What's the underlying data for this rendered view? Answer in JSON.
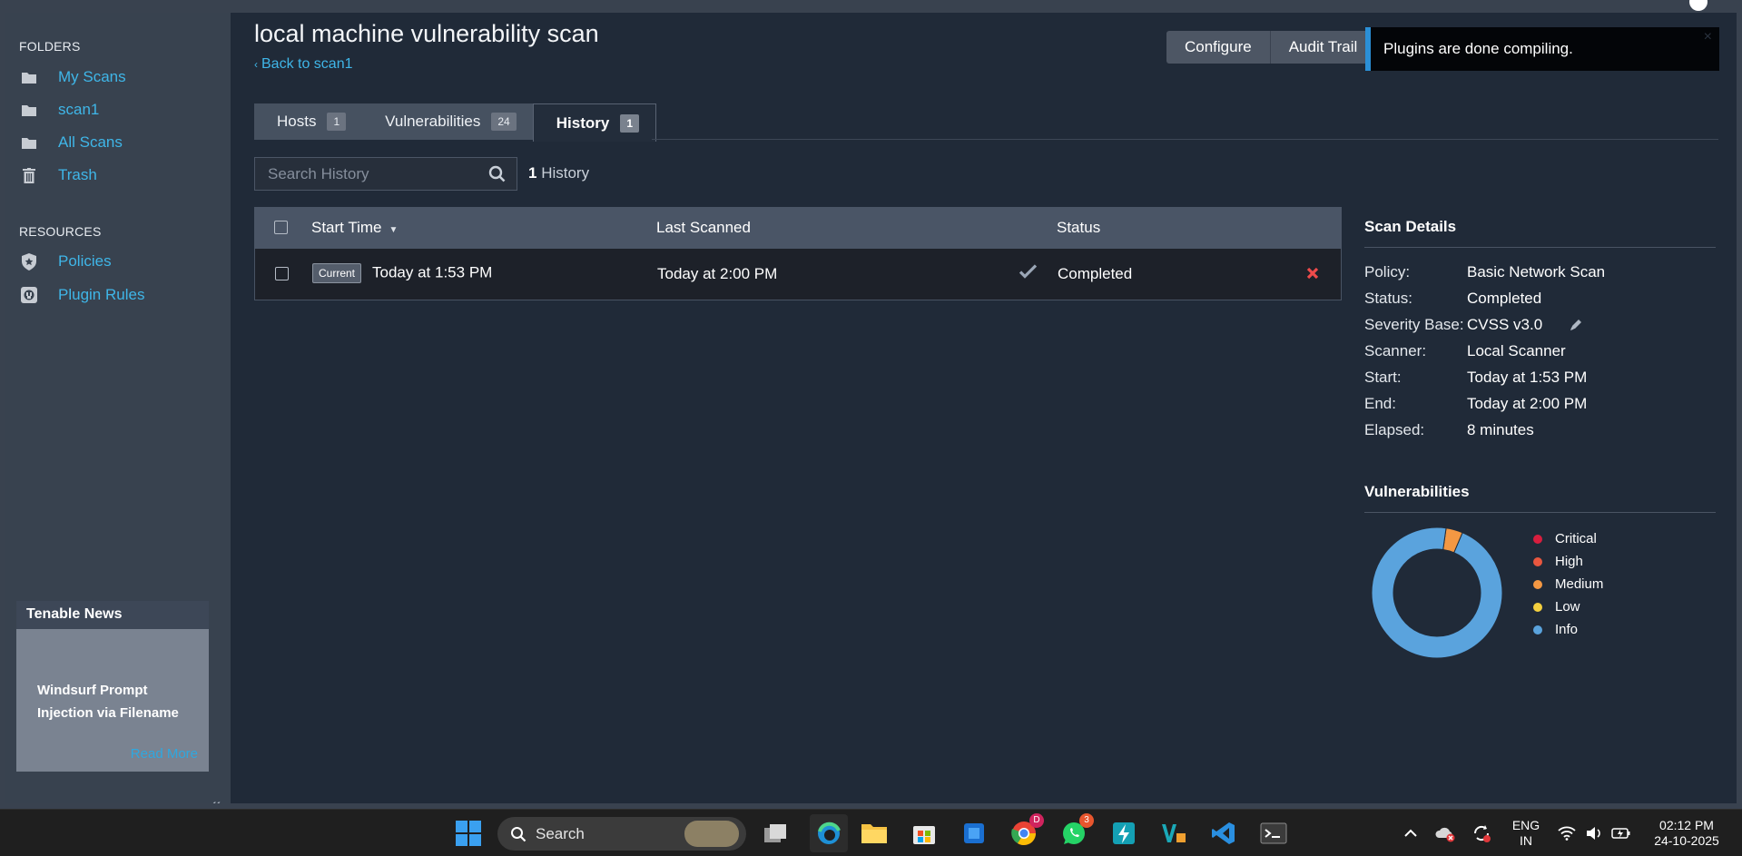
{
  "sidebar": {
    "folders_heading": "FOLDERS",
    "folders": [
      {
        "label": "My Scans",
        "icon": "folder-icon"
      },
      {
        "label": "scan1",
        "icon": "folder-icon"
      },
      {
        "label": "All Scans",
        "icon": "folder-icon"
      },
      {
        "label": "Trash",
        "icon": "trash-icon"
      }
    ],
    "resources_heading": "RESOURCES",
    "resources": [
      {
        "label": "Policies",
        "icon": "policy-icon"
      },
      {
        "label": "Plugin Rules",
        "icon": "plugin-rules-icon"
      }
    ],
    "news": {
      "heading": "Tenable News",
      "title": "Windsurf Prompt Injection via Filename",
      "read_more": "Read More"
    },
    "collapse_icon": "double-chevron-left-icon"
  },
  "header": {
    "title": "local machine vulnerability scan",
    "back_link": "Back to scan1",
    "configure": "Configure",
    "audit_trail": "Audit Trail"
  },
  "toast": {
    "message": "Plugins are done compiling.",
    "close": "×"
  },
  "tabs": [
    {
      "label": "Hosts",
      "count": "1"
    },
    {
      "label": "Vulnerabilities",
      "count": "24"
    },
    {
      "label": "History",
      "count": "1",
      "active": true
    }
  ],
  "search": {
    "placeholder": "Search History",
    "count_number": "1",
    "count_label": "History"
  },
  "history_table": {
    "columns": [
      "Start Time",
      "Last Scanned",
      "Status"
    ],
    "rows": [
      {
        "tag": "Current",
        "start_time": "Today at 1:53 PM",
        "last_scanned": "Today at 2:00 PM",
        "status": "Completed"
      }
    ]
  },
  "scan_details": {
    "heading": "Scan Details",
    "fields": [
      {
        "key": "Policy:",
        "value": "Basic Network Scan"
      },
      {
        "key": "Status:",
        "value": "Completed"
      },
      {
        "key": "Severity Base:",
        "value": "CVSS v3.0"
      },
      {
        "key": "Scanner:",
        "value": "Local Scanner"
      },
      {
        "key": "Start:",
        "value": "Today at 1:53 PM"
      },
      {
        "key": "End:",
        "value": "Today at 2:00 PM"
      },
      {
        "key": "Elapsed:",
        "value": "8 minutes"
      }
    ]
  },
  "vulnerabilities": {
    "heading": "Vulnerabilities",
    "legend": [
      {
        "label": "Critical",
        "color": "#d81e3e"
      },
      {
        "label": "High",
        "color": "#e9573f"
      },
      {
        "label": "Medium",
        "color": "#f49843"
      },
      {
        "label": "Low",
        "color": "#f4d03f"
      },
      {
        "label": "Info",
        "color": "#5aa3dd"
      }
    ],
    "chart_data": {
      "type": "pie",
      "categories": [
        "Critical",
        "High",
        "Medium",
        "Low",
        "Info"
      ],
      "values": [
        0,
        0,
        1,
        0,
        23
      ]
    }
  },
  "taskbar": {
    "search_label": "Search",
    "lang_line1": "ENG",
    "lang_line2": "IN",
    "time": "02:12 PM",
    "date": "24-10-2025",
    "chrome_badge": "D",
    "whatsapp_badge": "3"
  }
}
